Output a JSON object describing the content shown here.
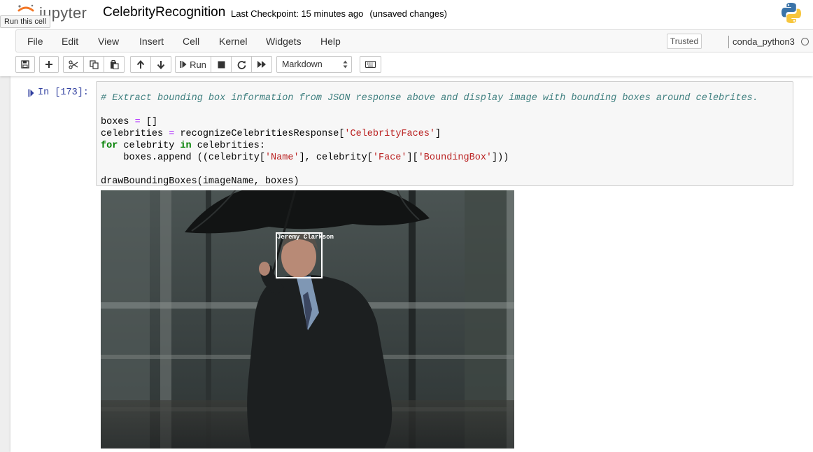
{
  "app": {
    "logo_text": "jupyter",
    "notebook_title": "CelebrityRecognition",
    "checkpoint_text": "Last Checkpoint: 15 minutes ago",
    "unsaved_text": "(unsaved changes)",
    "tooltip": "Run this cell"
  },
  "menubar": {
    "items": [
      "File",
      "Edit",
      "View",
      "Insert",
      "Cell",
      "Kernel",
      "Widgets",
      "Help"
    ],
    "trusted_label": "Trusted",
    "kernel_name": "conda_python3"
  },
  "toolbar": {
    "buttons": [
      "save-icon",
      "plus-icon",
      "scissors-icon",
      "copy-icon",
      "paste-icon",
      "arrow-up-icon",
      "arrow-down-icon",
      "run-icon",
      "stop-icon",
      "restart-icon",
      "fast-forward-icon",
      "keyboard-icon"
    ],
    "run_label": "Run",
    "cell_type_selected": "Markdown"
  },
  "cell": {
    "prompt": "In [173]:",
    "code": {
      "comment": "# Extract bounding box information from JSON response above and display image with bounding boxes around celebrites.",
      "boxes_var": "boxes",
      "eq": "=",
      "empty_list": "[]",
      "celebs_var": "celebrities",
      "response_var": "recognizeCelebritiesResponse",
      "celeb_faces_key": "'CelebrityFaces'",
      "for_kw": "for",
      "loop_var": "celebrity",
      "in_kw": "in",
      "append_call": "boxes.append ((celebrity[",
      "name_key": "'Name'",
      "mid_expr": "], celebrity[",
      "face_key": "'Face'",
      "bbox_key": "'BoundingBox'",
      "draw_call": "drawBoundingBoxes(imageName, boxes)"
    },
    "output": {
      "bbox_label": "Jeremy Clarkson"
    }
  }
}
